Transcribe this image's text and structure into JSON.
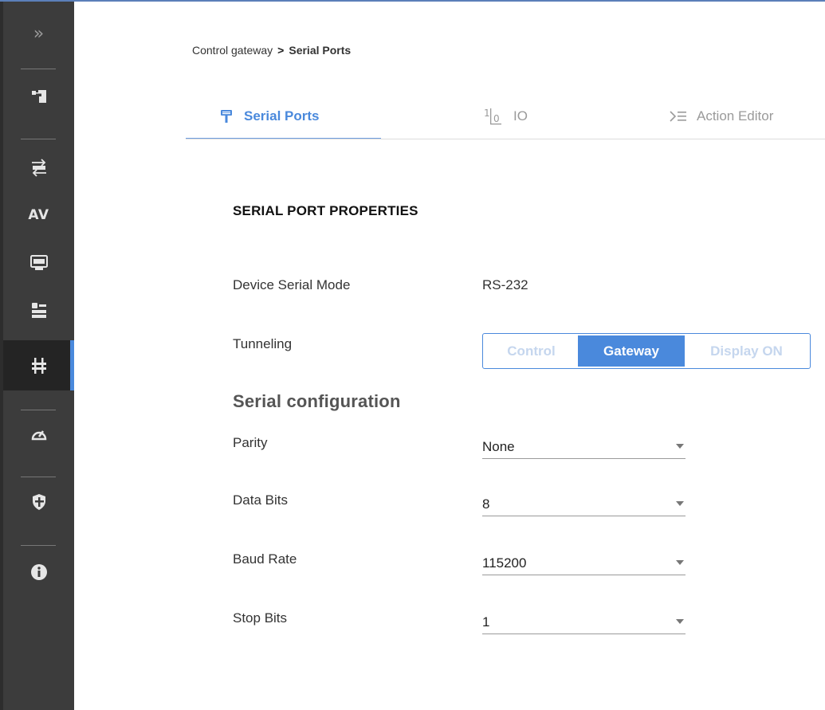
{
  "sidebar": {
    "items": [
      {
        "name": "expand-chevron-icon",
        "icon": "double-chevron-right"
      },
      {
        "name": "topology-icon",
        "icon": "topology"
      },
      {
        "name": "auto-switch-icon",
        "icon": "auto-switch"
      },
      {
        "name": "av-label",
        "text": "AV"
      },
      {
        "name": "edid-icon",
        "icon": "edid"
      },
      {
        "name": "settings-sliders-icon",
        "icon": "sliders"
      },
      {
        "name": "control-gateway-icon",
        "icon": "control-gateway",
        "active": true
      },
      {
        "name": "diagnostics-gauge-icon",
        "icon": "gauge"
      },
      {
        "name": "security-shield-icon",
        "icon": "shield"
      },
      {
        "name": "info-icon",
        "icon": "info"
      }
    ],
    "av_text": "AV",
    "chevron_text": "»"
  },
  "breadcrumb": {
    "parent": "Control gateway",
    "separator": ">",
    "current": "Serial Ports"
  },
  "tabs": [
    {
      "label": "Serial Ports",
      "icon": "serial-port-icon",
      "active": true
    },
    {
      "label": "IO",
      "icon": "io-icon",
      "active": false
    },
    {
      "label": "Action Editor",
      "icon": "action-editor-icon",
      "active": false
    }
  ],
  "main": {
    "section_title": "SERIAL PORT PROPERTIES",
    "device_serial_mode": {
      "label": "Device Serial Mode",
      "value": "RS-232"
    },
    "tunneling": {
      "label": "Tunneling",
      "options": [
        "Control",
        "Gateway",
        "Display ON"
      ],
      "selected": "Gateway"
    },
    "serial_config_heading": "Serial configuration",
    "fields": [
      {
        "label": "Parity",
        "value": "None"
      },
      {
        "label": "Data Bits",
        "value": "8"
      },
      {
        "label": "Baud Rate",
        "value": "115200"
      },
      {
        "label": "Stop Bits",
        "value": "1"
      }
    ]
  },
  "colors": {
    "accent": "#4a89dc",
    "sidebar_bg": "#3c3c3c",
    "active_item_bg": "#242424"
  }
}
